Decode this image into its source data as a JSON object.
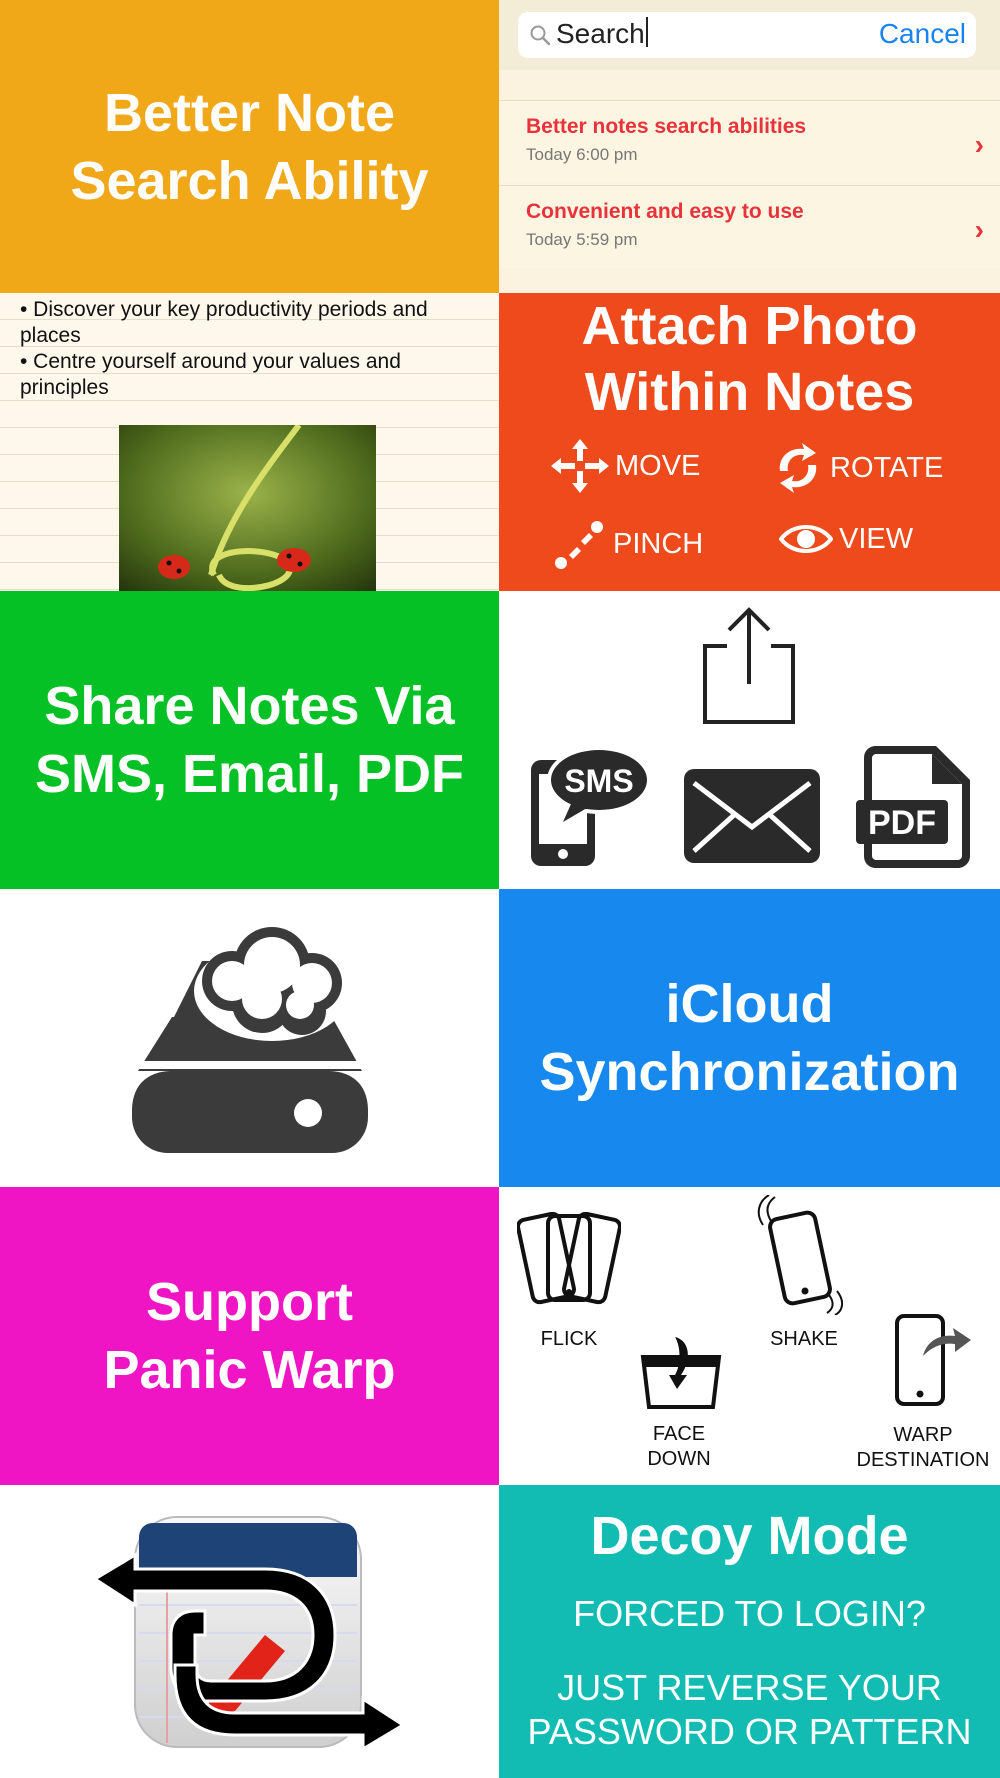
{
  "tiles": {
    "search_feature": {
      "line1": "Better Note",
      "line2": "Search Ability",
      "color": "#f0a718"
    },
    "search_screen": {
      "search_text": "Search",
      "cancel_label": "Cancel",
      "results": [
        {
          "title": "Better notes search abilities",
          "date": "Today 6:00 pm"
        },
        {
          "title": "Convenient and easy to use",
          "date": "Today 5:59 pm"
        }
      ]
    },
    "note_sample": {
      "bullets": [
        "• Discover your key productivity periods and places",
        "• Centre yourself around your values and principles"
      ]
    },
    "attach_feature": {
      "line1": "Attach Photo",
      "line2": "Within Notes",
      "gestures": {
        "move": "MOVE",
        "rotate": "ROTATE",
        "pinch": "PINCH",
        "view": "VIEW"
      },
      "color": "#ef4a1b"
    },
    "share_feature": {
      "line1": "Share Notes Via",
      "line2": "SMS, Email, PDF",
      "color": "#06c125"
    },
    "share_icons": {
      "sms_label": "SMS",
      "pdf_label": "PDF"
    },
    "icloud_feature": {
      "line1": "iCloud",
      "line2": "Synchronization",
      "color": "#1789ee"
    },
    "panic_feature": {
      "line1": "Support",
      "line2": "Panic Warp",
      "color": "#ef15c4"
    },
    "panic_gestures": {
      "flick": "FLICK",
      "shake": "SHAKE",
      "face_down_1": "FACE",
      "face_down_2": "DOWN",
      "warp_1": "WARP",
      "warp_2": "DESTINATION"
    },
    "decoy_feature": {
      "title": "Decoy Mode",
      "line1": "FORCED TO LOGIN?",
      "line2": "JUST REVERSE YOUR",
      "line3": "PASSWORD OR PATTERN",
      "color": "#13bcb3"
    }
  }
}
